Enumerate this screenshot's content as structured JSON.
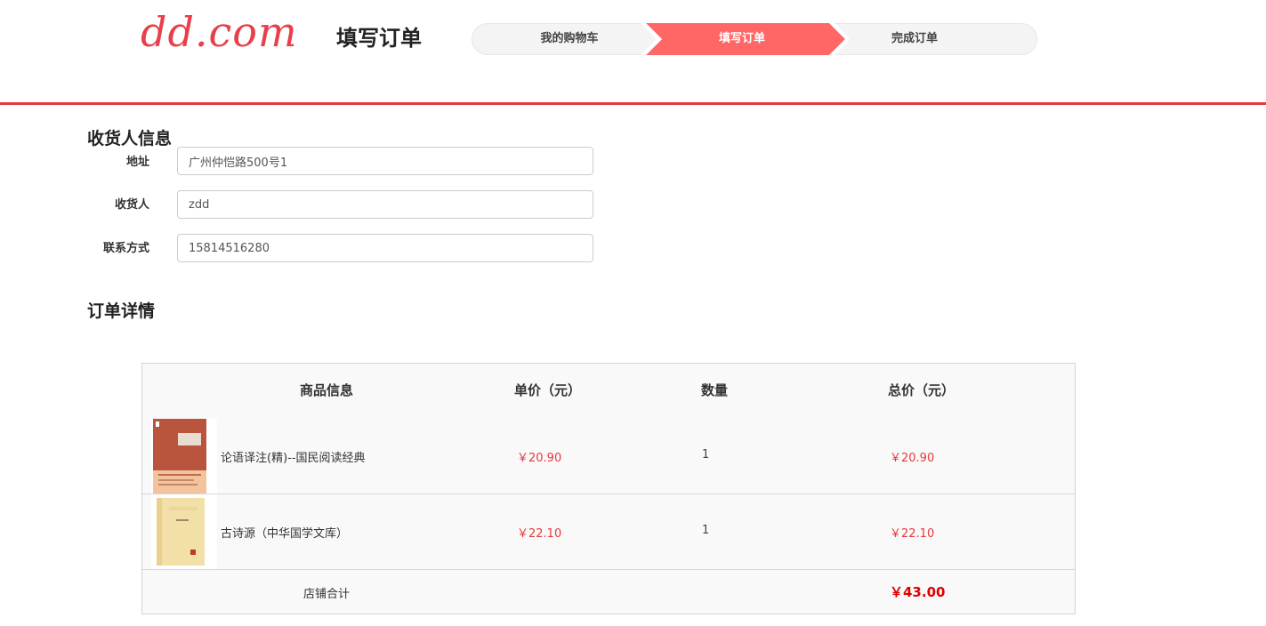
{
  "header": {
    "logo_text": "dd.com",
    "page_title": "填写订单",
    "steps": [
      "我的购物车",
      "填写订单",
      "完成订单"
    ],
    "active_step": 1,
    "accent_color": "#e8383d",
    "step_active_color": "#ff6666"
  },
  "receiver": {
    "section_title": "收货人信息",
    "fields": [
      {
        "label": "地址",
        "value": "广州仲恺路500号1"
      },
      {
        "label": "收货人",
        "value": "zdd"
      },
      {
        "label": "联系方式",
        "value": "15814516280"
      }
    ]
  },
  "order": {
    "section_title": "订单详情",
    "columns": [
      "商品信息",
      "单价（元）",
      "数量",
      "总价（元）"
    ],
    "items": [
      {
        "title": "论语译注(精)--国民阅读经典",
        "price": "￥20.90",
        "qty": "1",
        "total": "￥20.90",
        "cover": "book-cover-lunyu"
      },
      {
        "title": "古诗源（中华国学文库）",
        "price": "￥22.10",
        "qty": "1",
        "total": "￥22.10",
        "cover": "book-cover-gushiyuan"
      }
    ],
    "summary_label": "店铺合计",
    "summary_value": "￥43.00"
  }
}
